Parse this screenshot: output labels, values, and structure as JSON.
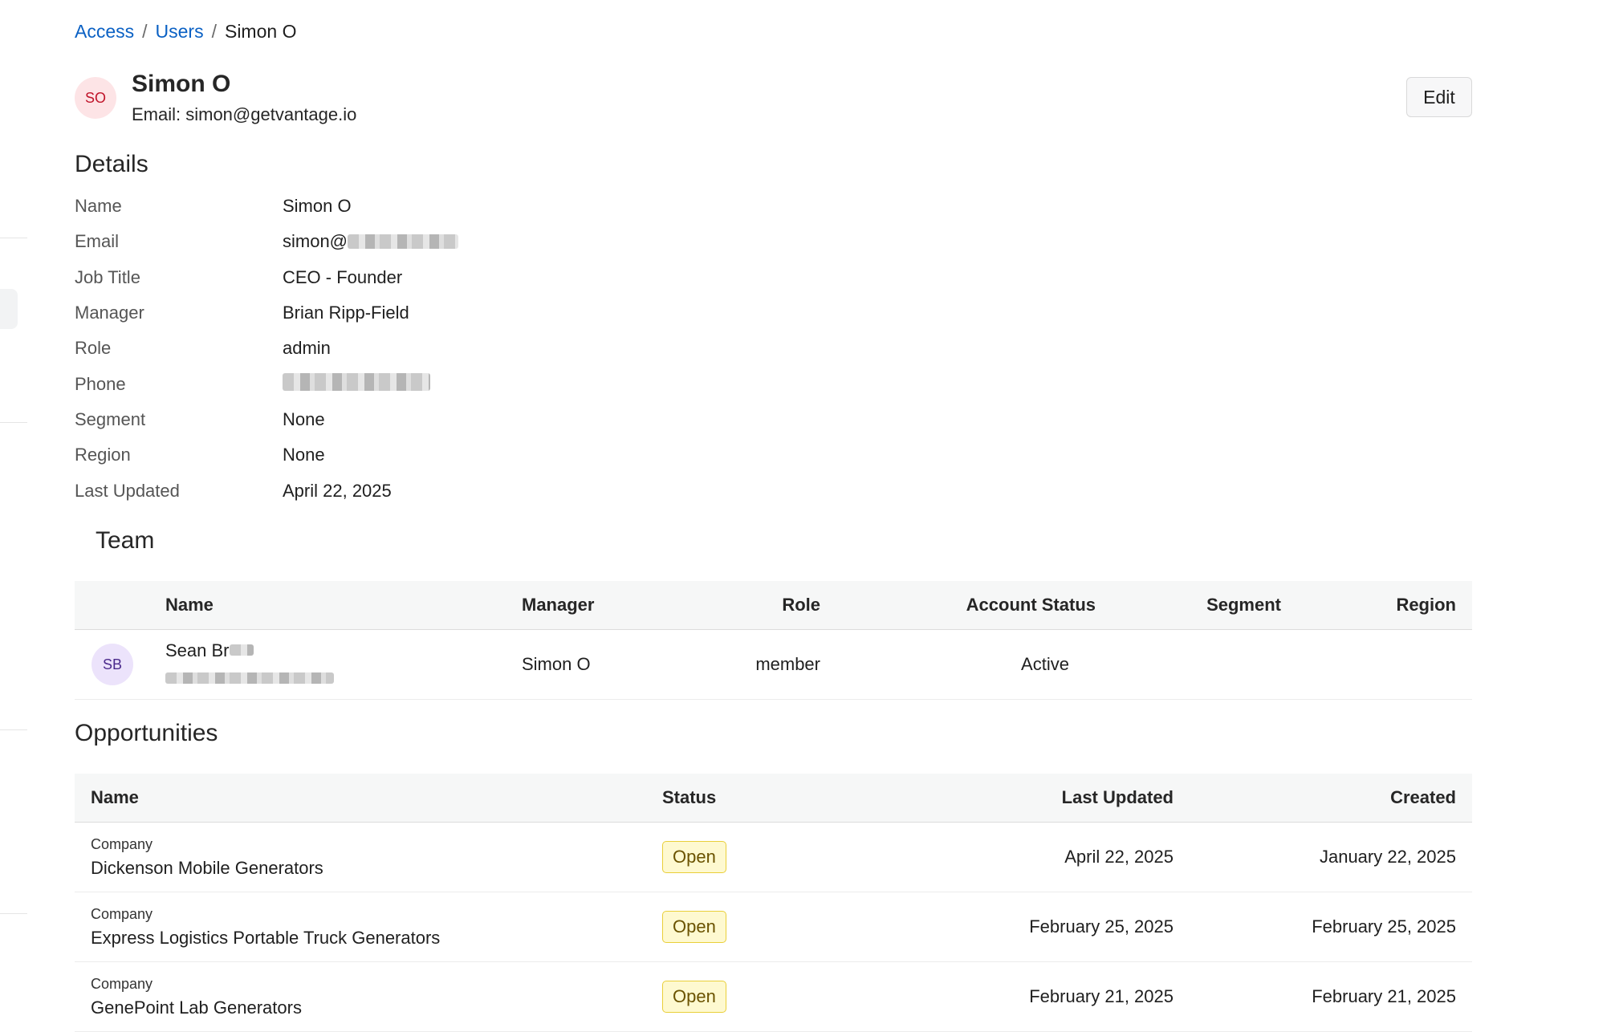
{
  "breadcrumb": {
    "access": "Access",
    "users": "Users",
    "current": "Simon O",
    "sep": "/"
  },
  "user": {
    "initials": "SO",
    "name": "Simon O",
    "email_line": "Email: simon@getvantage.io"
  },
  "actions": {
    "edit_label": "Edit"
  },
  "details": {
    "title": "Details",
    "name_label": "Name",
    "name_value": "Simon O",
    "email_label": "Email",
    "email_value": "simon@",
    "job_label": "Job Title",
    "job_value": "CEO - Founder",
    "manager_label": "Manager",
    "manager_value": "Brian Ripp-Field",
    "role_label": "Role",
    "role_value": "admin",
    "phone_label": "Phone",
    "segment_label": "Segment",
    "segment_value": "None",
    "region_label": "Region",
    "region_value": "None",
    "updated_label": "Last Updated",
    "updated_value": "April 22, 2025"
  },
  "team": {
    "title": "Team",
    "headers": {
      "name": "Name",
      "manager": "Manager",
      "role": "Role",
      "status": "Account Status",
      "segment": "Segment",
      "region": "Region"
    },
    "members": [
      {
        "initials": "SB",
        "name": "Sean Br",
        "manager": "Simon O",
        "role": "member",
        "status": "Active"
      }
    ]
  },
  "opportunities": {
    "title": "Opportunities",
    "headers": {
      "name": "Name",
      "status": "Status",
      "updated": "Last Updated",
      "created": "Created"
    },
    "rows": [
      {
        "type": "Company",
        "name": "Dickenson Mobile Generators",
        "status": "Open",
        "updated": "April 22, 2025",
        "created": "January 22, 2025"
      },
      {
        "type": "Company",
        "name": "Express Logistics Portable Truck Generators",
        "status": "Open",
        "updated": "February 25, 2025",
        "created": "February 25, 2025"
      },
      {
        "type": "Company",
        "name": "GenePoint Lab Generators",
        "status": "Open",
        "updated": "February 21, 2025",
        "created": "February 21, 2025"
      }
    ]
  }
}
